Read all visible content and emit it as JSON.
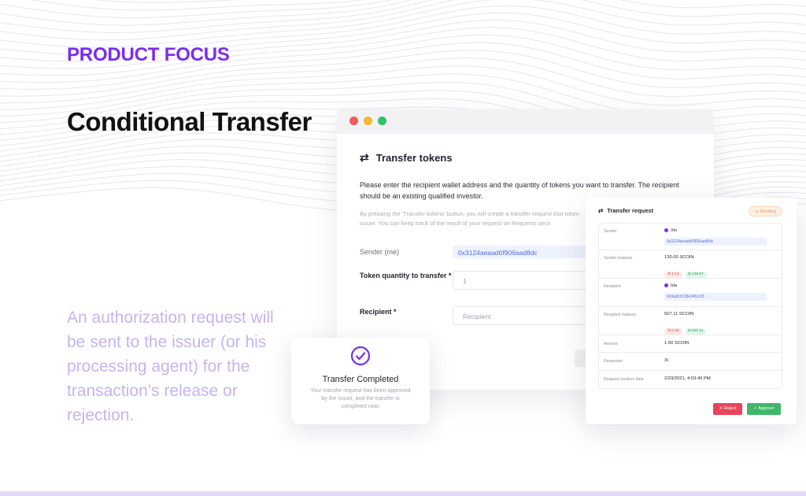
{
  "slide": {
    "eyebrow": "PRODUCT FOCUS",
    "headline": "Conditional Transfer",
    "blurb": "An authorization request will be sent to the issuer (or his processing agent) for the transaction’s release or rejection."
  },
  "colors": {
    "accent": "#7a2df0",
    "blurb": "#c6b3f3",
    "approve": "#3fb769",
    "reject": "#e8455a"
  },
  "transfer_form": {
    "title": "Transfer tokens",
    "icon": "swap-arrows-icon",
    "lead": "Please enter the recipient wallet address and the quantity of tokens you want to transfer. The recipient should be an existing qualified investor.",
    "note": "By pressing the 'Transfer tokens' button, you will create a transfer request that token issuer. You can keep track of the result of your request on Requests secti",
    "sender_label": "Sender (me)",
    "sender_value": "0x3124aeaad6f906aad8dc",
    "quantity_label": "Token quantity to transfer *",
    "quantity_placeholder": "1",
    "recipient_label": "Recipient *",
    "recipient_placeholder": "Recipient"
  },
  "completed_card": {
    "icon": "check-circle-icon",
    "title": "Transfer Completed",
    "text": "Your transfer request has been approved by the issuer, and the transfer is completed now."
  },
  "request_card": {
    "title": "Transfer request",
    "status": "Pending",
    "rows": {
      "sender_label": "Sender",
      "sender_name": "Xin",
      "sender_address": "0x3124aeaad6f906aad8dc",
      "sender_balance_label": "Sender balance",
      "sender_balance": "130.00 SCOIN",
      "sender_locked": "1.13",
      "sender_available": "128.87",
      "recipient_label": "Recipient",
      "recipient_name": "Ida",
      "recipient_address": "0x3adc3218e34fcc33",
      "recipient_balance_label": "Recipient balance",
      "recipient_balance": "507.11 SCOIN",
      "recipient_locked": "0.06",
      "recipient_available": "507.11",
      "amount_label": "Amount",
      "amount": "1.60 SCOIN",
      "requester_label": "Requester",
      "requester": "Xi",
      "date_label": "Request creation date",
      "date": "2/23/2021, 4:03:49 PM"
    },
    "reject_label": "Reject",
    "approve_label": "Approve"
  }
}
